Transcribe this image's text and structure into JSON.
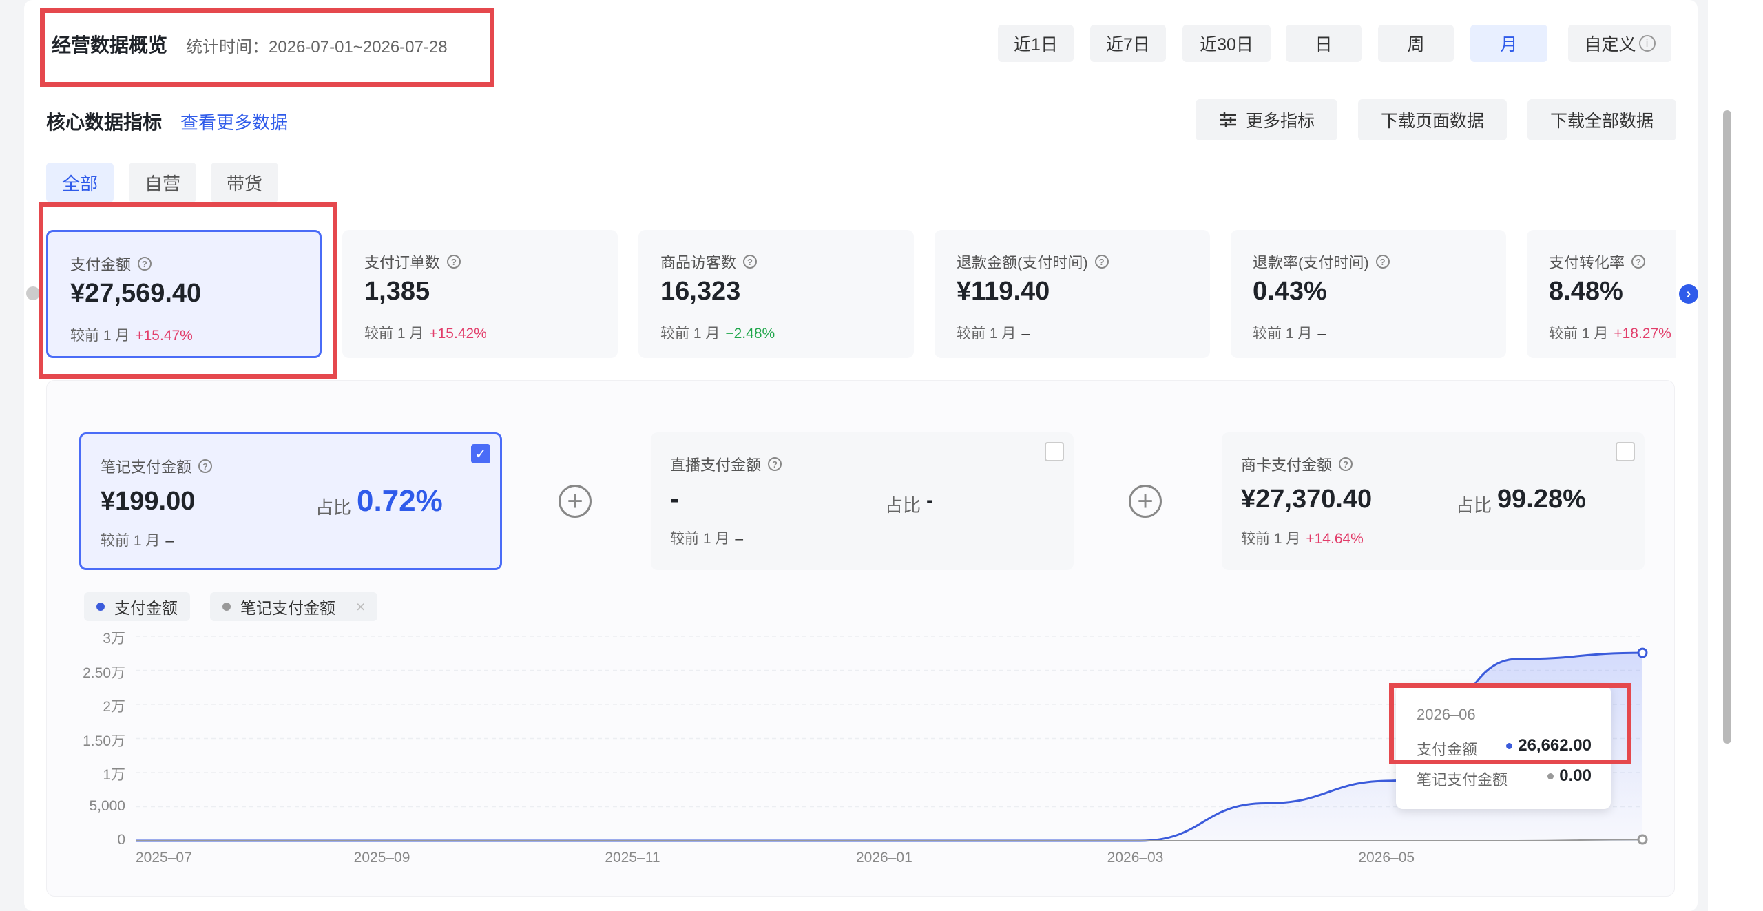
{
  "header": {
    "title": "经营数据概览",
    "time_label": "统计时间：2026-07-01~2026-07-28",
    "time_tabs": [
      "近1日",
      "近7日",
      "近30日",
      "日",
      "周",
      "月",
      "自定义"
    ],
    "active_time_tab": "月"
  },
  "core": {
    "title": "核心数据指标",
    "more_link": "查看更多数据",
    "buttons": [
      "更多指标",
      "下载页面数据",
      "下载全部数据"
    ],
    "sub_tabs": [
      "全部",
      "自营",
      "带货"
    ],
    "active_sub_tab": "全部"
  },
  "cards": [
    {
      "label": "支付金额",
      "value": "¥27,569.40",
      "cmp_label": "较前 1 月",
      "cmp": "+15.47%",
      "trend": "up"
    },
    {
      "label": "支付订单数",
      "value": "1,385",
      "cmp_label": "较前 1 月",
      "cmp": "+15.42%",
      "trend": "up"
    },
    {
      "label": "商品访客数",
      "value": "16,323",
      "cmp_label": "较前 1 月",
      "cmp": "−2.48%",
      "trend": "down"
    },
    {
      "label": "退款金额(支付时间)",
      "value": "¥119.40",
      "cmp_label": "较前 1 月",
      "cmp": "–",
      "trend": "flat"
    },
    {
      "label": "退款率(支付时间)",
      "value": "0.43%",
      "cmp_label": "较前 1 月",
      "cmp": "–",
      "trend": "flat"
    },
    {
      "label": "支付转化率",
      "value": "8.48%",
      "cmp_label": "较前 1 月",
      "cmp": "+18.27%",
      "trend": "up"
    }
  ],
  "breakdown": [
    {
      "label": "笔记支付金额",
      "value": "¥199.00",
      "ratio_label": "占比",
      "ratio": "0.72%",
      "cmp_label": "较前 1 月",
      "cmp": "–",
      "checked": true
    },
    {
      "label": "直播支付金额",
      "value": "-",
      "ratio_label": "占比",
      "ratio": "-",
      "cmp_label": "较前 1 月",
      "cmp": "–",
      "checked": false
    },
    {
      "label": "商卡支付金额",
      "value": "¥27,370.40",
      "ratio_label": "占比",
      "ratio": "99.28%",
      "cmp_label": "较前 1 月",
      "cmp": "+14.64%",
      "checked": false
    }
  ],
  "legend": [
    {
      "name": "支付金额",
      "color": "#3b5bdb"
    },
    {
      "name": "笔记支付金额",
      "color": "#999999"
    }
  ],
  "chart_data": {
    "type": "area",
    "x": [
      "2025-07",
      "2025-08",
      "2025-09",
      "2025-10",
      "2025-11",
      "2025-12",
      "2026-01",
      "2026-02",
      "2026-03",
      "2026-04",
      "2026-05",
      "2026-06",
      "2026-07"
    ],
    "x_tick_labels": [
      "2025–07",
      "2025–09",
      "2025–11",
      "2026–01",
      "2026–03",
      "2026–05"
    ],
    "y_tick_labels": [
      "0",
      "5,000",
      "1万",
      "1.50万",
      "2万",
      "2.50万",
      "3万"
    ],
    "ylim": [
      0,
      30000
    ],
    "series": [
      {
        "name": "支付金额",
        "color": "#3b5bdb",
        "values": [
          0,
          0,
          0,
          0,
          0,
          0,
          0,
          0,
          0,
          5500,
          8800,
          26662,
          27569.4
        ]
      },
      {
        "name": "笔记支付金额",
        "color": "#999999",
        "values": [
          0,
          0,
          0,
          0,
          0,
          0,
          0,
          0,
          0,
          0,
          0,
          0,
          199
        ]
      }
    ],
    "tooltip": {
      "date": "2026–06",
      "rows": [
        {
          "name": "支付金额",
          "value": "26,662.00",
          "color": "#3b5bdb"
        },
        {
          "name": "笔记支付金额",
          "value": "0.00",
          "color": "#999999"
        }
      ]
    }
  }
}
